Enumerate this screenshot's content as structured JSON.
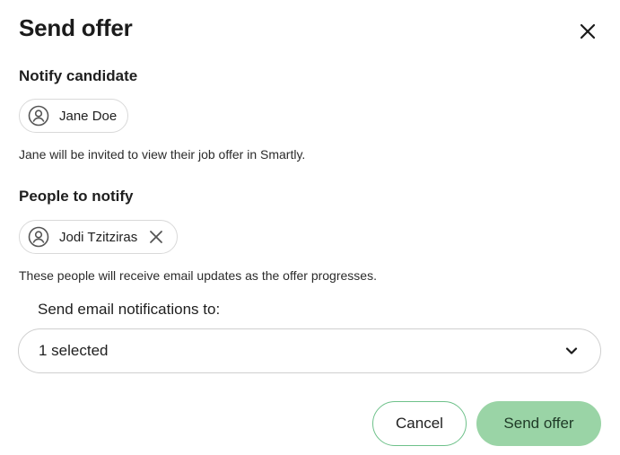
{
  "dialog": {
    "title": "Send offer",
    "close_icon": "close-icon"
  },
  "notify_candidate": {
    "label": "Notify candidate",
    "chip": {
      "name": "Jane Doe",
      "icon": "user-circle-icon"
    },
    "helper": "Jane will be invited to view their job offer in Smartly."
  },
  "people_to_notify": {
    "label": "People to notify",
    "chip": {
      "name": "Jodi Tzitziras",
      "icon": "user-circle-icon",
      "remove_icon": "close-icon"
    },
    "helper": "These people will receive email updates as the offer progresses."
  },
  "email_notifications": {
    "label": "Send email notifications to:",
    "value": "1 selected",
    "icon": "chevron-down-icon"
  },
  "actions": {
    "cancel_label": "Cancel",
    "send_label": "Send offer"
  },
  "colors": {
    "accent_border": "#6ec18a",
    "primary_button": "#9ad4a6"
  }
}
